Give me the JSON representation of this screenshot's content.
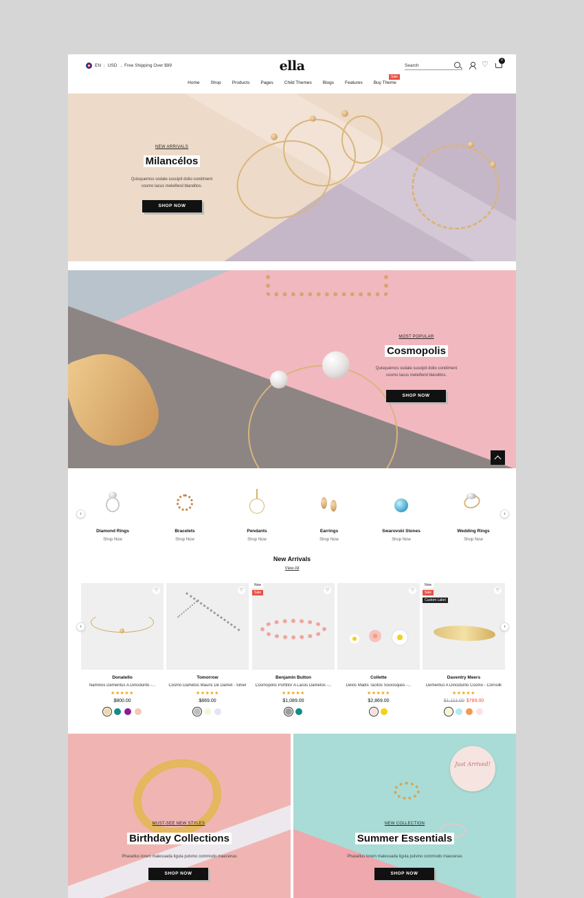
{
  "header": {
    "language": "EN",
    "currency": "USD",
    "shipping_note": "Free Shipping Over $99",
    "logo": "ella",
    "search_placeholder": "Search",
    "cart_count": "0",
    "nav": [
      "Home",
      "Shop",
      "Products",
      "Pages",
      "Child Themes",
      "Blogs",
      "Features",
      "Buy Theme"
    ],
    "nav_badge": "Sale"
  },
  "hero1": {
    "kicker": "NEW ARRIVALS",
    "title": "Milancélos",
    "desc": "Quisquemos sodale suscipit dolio condiment cosmo lacus meleifend blanditos.",
    "button": "SHOP NOW"
  },
  "hero2": {
    "kicker": "MOST POPULAR",
    "title": "Cosmopolis",
    "desc": "Quisquemos sodale suscipit dolio condiment cosmo lacus meleifend blanditos.",
    "button": "SHOP NOW"
  },
  "categories": [
    {
      "name": "Diamond Rings",
      "link": "Shop Now"
    },
    {
      "name": "Bracelets",
      "link": "Shop Now"
    },
    {
      "name": "Pendants",
      "link": "Shop Now"
    },
    {
      "name": "Earrings",
      "link": "Shop Now"
    },
    {
      "name": "Swarovski Stones",
      "link": "Shop Now"
    },
    {
      "name": "Wedding Rings",
      "link": "Shop Now"
    }
  ],
  "new_arrivals": {
    "title": "New Arrivals",
    "view_all": "View All"
  },
  "products": [
    {
      "name": "Donatello",
      "desc": "Naminos Dementus A Dincidunto -...",
      "price": "$800.00",
      "rating": 5,
      "swatches": [
        "#f3d5a8",
        "#148c85",
        "#8b1e8f",
        "#f6c7b4"
      ]
    },
    {
      "name": "Tomorrow",
      "desc": "Cosmo Dametos Mauris De Damet - Silver",
      "price": "$869.00",
      "rating": 5,
      "swatches": [
        "#bdbdbd",
        "#f4f6d9",
        "#e5e3f6"
      ]
    },
    {
      "name": "Benjamin Button",
      "desc": "Cosmopolis Porttitor A Lacos Dametos -...",
      "price": "$1,089.00",
      "rating": 5,
      "swatches": [
        "#9c9c9c",
        "#148c85"
      ],
      "badges": [
        "Now",
        "Sale"
      ]
    },
    {
      "name": "Collette",
      "desc": "Delos Madis Tacitos Sociosques -...",
      "price": "$2,869.00",
      "rating": 5,
      "swatches": [
        "#f6dfe0",
        "#f2d21b"
      ]
    },
    {
      "name": "Daventry Meers",
      "desc": "Dementus A Dincidunto Cosmo - Cornsilk",
      "old_price": "$1,111.00",
      "price": "$789.00",
      "rating": 5,
      "swatches": [
        "#fcf3d3",
        "#b3ecee",
        "#f29a53",
        "#fbe2e2"
      ],
      "badges": [
        "Now",
        "Sale",
        "Custom Label"
      ]
    }
  ],
  "promo_left": {
    "kicker": "MUST-SEE NEW STYLES",
    "title": "Birthday Collections",
    "desc": "Phasellus lorem malesuada ligula pulvino commodo maecenas",
    "button": "SHOP NOW"
  },
  "promo_right": {
    "kicker": "NEW COLLECTION",
    "title": "Summer Essentials",
    "desc": "Phasellus lorem malesuada ligula pulvino commodo maecenas",
    "button": "SHOP NOW",
    "sticker": "Just Arrived!"
  },
  "colors": {
    "accent": "#e95144",
    "dark": "#111111",
    "star": "#f2a31b"
  }
}
